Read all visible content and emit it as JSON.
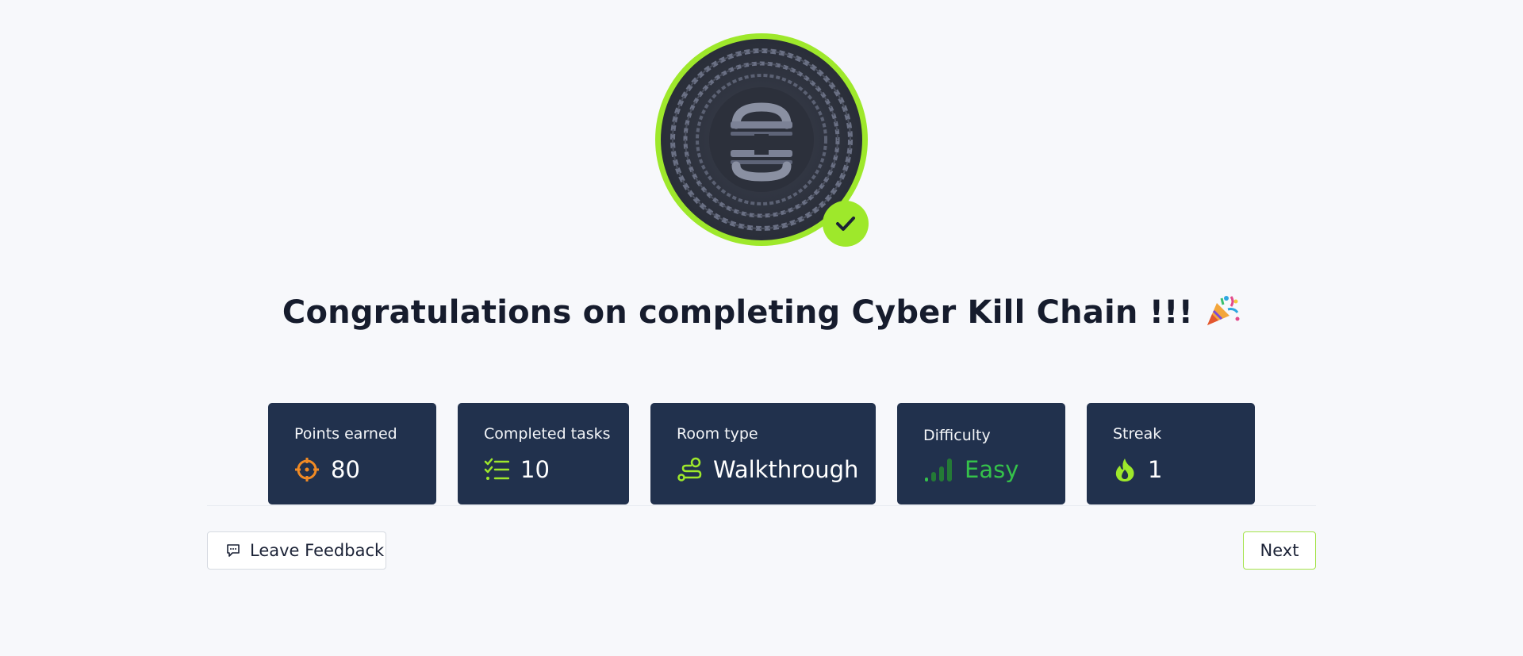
{
  "badge": {
    "icon": "chain-badge-icon",
    "completed_icon": "checkmark-icon",
    "ring_color": "#9ee82b"
  },
  "heading": {
    "text": "Congratulations on completing Cyber Kill Chain !!!",
    "emoji_icon": "party-popper-icon"
  },
  "stats": [
    {
      "label": "Points earned",
      "value": "80",
      "icon": "target-icon",
      "icon_color": "#f08a24"
    },
    {
      "label": "Completed tasks",
      "value": "10",
      "icon": "task-list-icon",
      "icon_color": "#9ee82b"
    },
    {
      "label": "Room type",
      "value": "Walkthrough",
      "icon": "route-icon",
      "icon_color": "#9ee82b"
    },
    {
      "label": "Difficulty",
      "value": "Easy",
      "icon": "signal-bars-icon",
      "icon_color": "#35c24a"
    },
    {
      "label": "Streak",
      "value": "1",
      "icon": "flame-icon",
      "icon_color": "#9ee82b"
    }
  ],
  "actions": {
    "feedback_label": "Leave Feedback",
    "next_label": "Next"
  },
  "colors": {
    "card_bg": "#21314d",
    "accent": "#9ee82b",
    "page_bg": "#f7f8fb"
  }
}
